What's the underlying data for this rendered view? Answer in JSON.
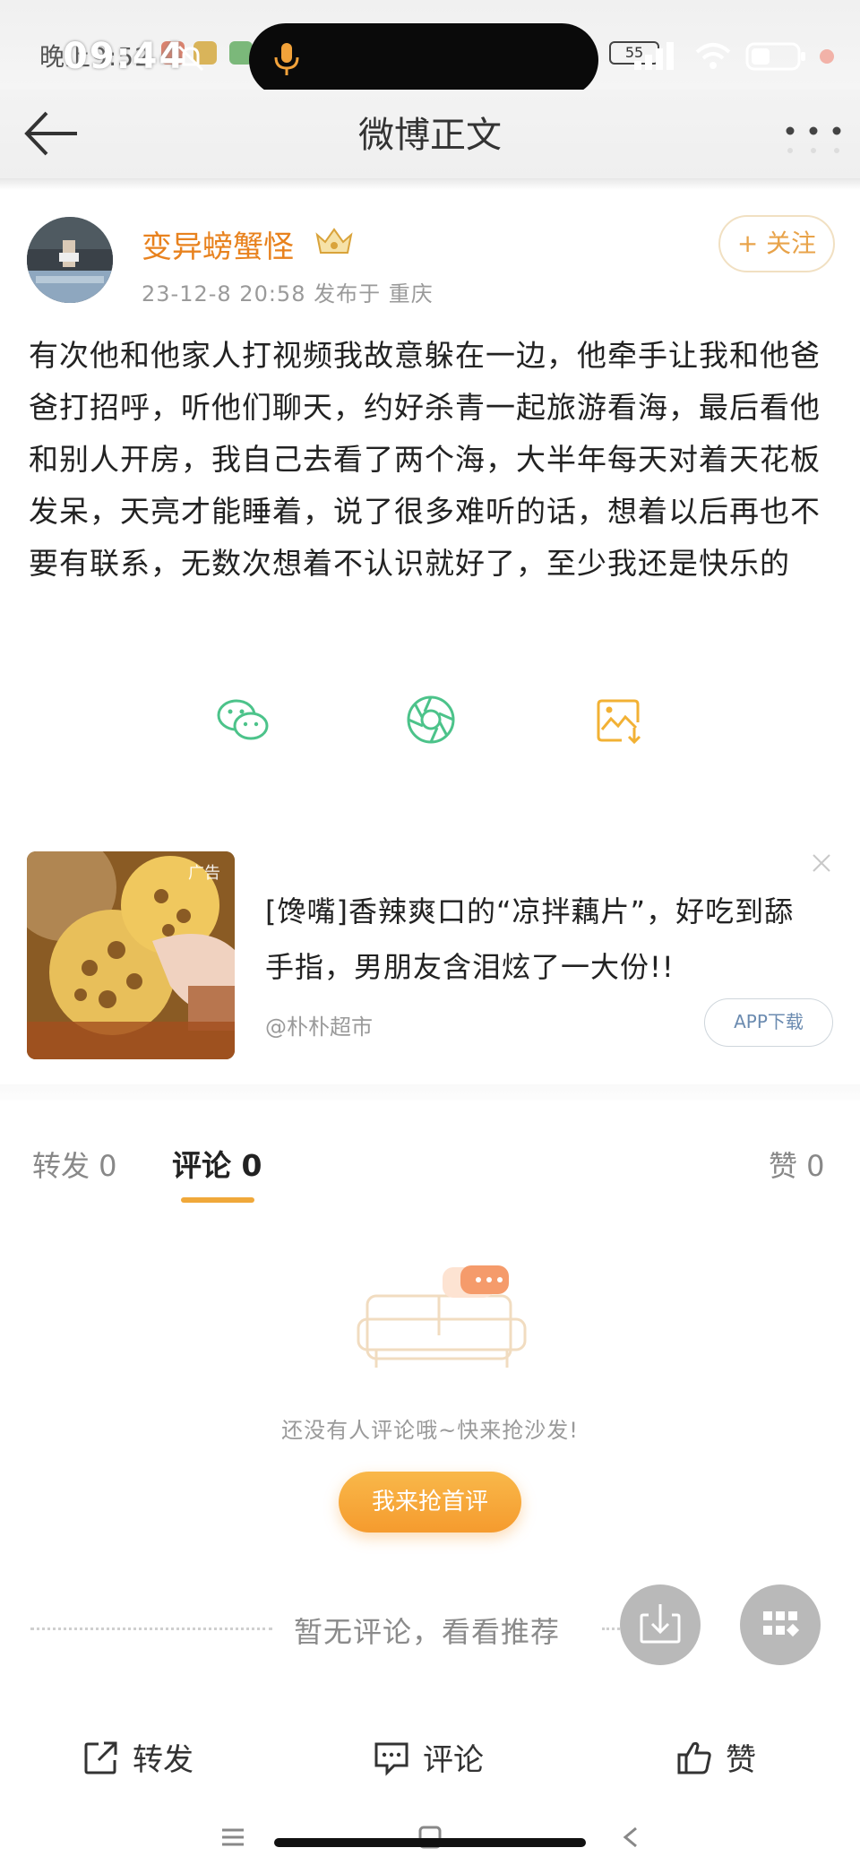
{
  "status_bar": {
    "ghost_time": "晚上9:52",
    "time": "09:44",
    "signal_badge": "55"
  },
  "nav": {
    "title": "微博正文"
  },
  "post": {
    "author": "变异螃蟹怪",
    "meta": "23-12-8 20:58  发布于 重庆",
    "follow_label": "+ 关注",
    "text": "有次他和他家人打视频我故意躲在一边，他牵手让我和他爸爸打招呼，听他们聊天，约好杀青一起旅游看海，最后看他和别人开房，我自己去看了两个海，大半年每天对着天花板发呆，天亮才能睡着，说了很多难听的话，想着以后再也不要有联系，无数次想着不认识就好了，至少我还是快乐的"
  },
  "share": {
    "icons": [
      "wechat-icon",
      "moments-icon",
      "save-image-icon"
    ],
    "colors": {
      "green": "#4cc38a",
      "yellow": "#f2b134"
    }
  },
  "ad": {
    "label": "广告",
    "title": "[馋嘴]香辣爽口的“凉拌藕片”，好吃到舔手指，男朋友含泪炫了一大份!!",
    "source": "@朴朴超市",
    "button": "APP下载"
  },
  "tabs": {
    "repost": "转发 0",
    "comment": "评论 0",
    "like": "赞 0"
  },
  "empty": {
    "text": "还没有人评论哦~快来抢沙发!",
    "button": "我来抢首评"
  },
  "recommend": {
    "text": "暂无评论，看看推荐"
  },
  "actions": {
    "repost": "转发",
    "comment": "评论",
    "like": "赞"
  },
  "accent_color": "#f0a83a"
}
